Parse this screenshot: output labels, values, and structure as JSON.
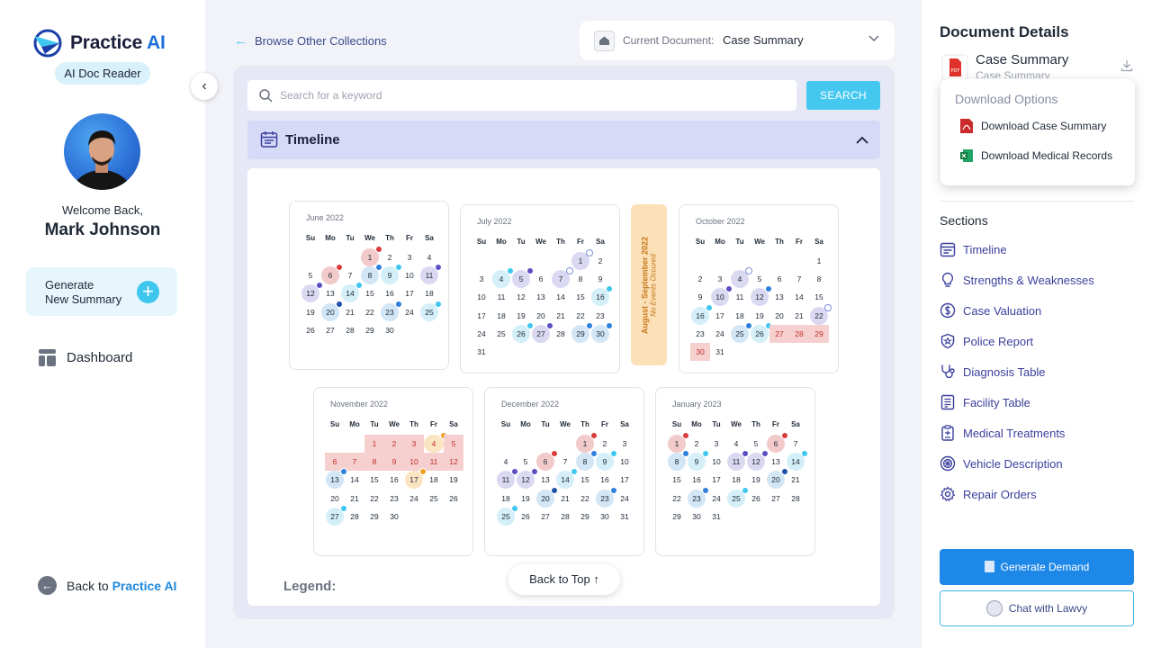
{
  "brand": {
    "name_part1": "Practice",
    "name_part2": "AI",
    "badge": "AI Doc Reader",
    "accent": "#1e6fd9"
  },
  "user": {
    "welcome": "Welcome Back,",
    "name": "Mark Johnson"
  },
  "sidebar": {
    "generate_label_line1": "Generate",
    "generate_label_line2": "New Summary",
    "nav": [
      {
        "label": "Dashboard",
        "icon": "dashboard-icon"
      }
    ],
    "back_prefix": "Back to",
    "back_link": "Practice AI"
  },
  "main": {
    "browse_label": "Browse Other Collections",
    "current_doc_label": "Current Document:",
    "current_doc_value": "Case Summary",
    "search": {
      "placeholder": "Search for a keyword",
      "button": "SEARCH"
    },
    "section_title": "Timeline",
    "gap_title": "August - September 2022",
    "gap_sub": "No Events Occured",
    "legend_label": "Legend:",
    "back_to_top": "Back to Top"
  },
  "weekdays": [
    "Su",
    "Mo",
    "Tu",
    "We",
    "Th",
    "Fr",
    "Sa"
  ],
  "calendars": [
    {
      "name": "June 2022",
      "start": 3,
      "days": 30,
      "marks": {
        "1": [
          "red",
          "r"
        ],
        "6": [
          "red",
          "r"
        ],
        "8": [
          "blue",
          "b"
        ],
        "9": [
          "cyan",
          "c"
        ],
        "11": [
          "purple",
          "p"
        ],
        "12": [
          "purple",
          "p"
        ],
        "14": [
          "cyan",
          "c"
        ],
        "20": [
          "blue",
          "bl"
        ],
        "23": [
          "blue",
          "b"
        ],
        "25": [
          "cyan",
          "c"
        ]
      }
    },
    {
      "name": "July 2022",
      "start": 5,
      "days": 31,
      "marks": {
        "1": [
          "purple",
          "ring"
        ],
        "4": [
          "cyan",
          "c"
        ],
        "5": [
          "purple",
          "p"
        ],
        "7": [
          "purple",
          "ring"
        ],
        "16": [
          "cyan",
          "c"
        ],
        "26": [
          "cyan",
          "c"
        ],
        "27": [
          "purple",
          "p"
        ],
        "29": [
          "blue",
          "b"
        ],
        "30": [
          "blue",
          "b"
        ]
      }
    },
    {
      "name": "October 2022",
      "start": 6,
      "days": 31,
      "marks": {
        "4": [
          "purple",
          "ring"
        ],
        "10": [
          "purple",
          "p"
        ],
        "12": [
          "purple",
          "b"
        ],
        "16": [
          "cyan",
          "c"
        ],
        "22": [
          "purple",
          "ring"
        ],
        "25": [
          "blue",
          "b"
        ],
        "26": [
          "cyan",
          "c"
        ]
      },
      "range": [
        27,
        30
      ]
    },
    {
      "name": "November 2022",
      "start": 2,
      "days": 30,
      "marks": {
        "4": [
          "orange",
          "o"
        ],
        "13": [
          "blue",
          "b"
        ],
        "17": [
          "orange",
          "o"
        ],
        "27": [
          "cyan",
          "c"
        ]
      },
      "range": [
        1,
        12
      ]
    },
    {
      "name": "December 2022",
      "start": 4,
      "days": 31,
      "marks": {
        "1": [
          "red",
          "r"
        ],
        "6": [
          "red",
          "r"
        ],
        "8": [
          "blue",
          "b"
        ],
        "9": [
          "cyan",
          "c"
        ],
        "11": [
          "purple",
          "p"
        ],
        "12": [
          "purple",
          "p"
        ],
        "14": [
          "cyan",
          "c"
        ],
        "20": [
          "blue",
          "bl"
        ],
        "23": [
          "blue",
          "b"
        ],
        "25": [
          "cyan",
          "c"
        ]
      }
    },
    {
      "name": "January 2023",
      "start": 0,
      "days": 31,
      "marks": {
        "1": [
          "red",
          "r"
        ],
        "6": [
          "red",
          "r"
        ],
        "8": [
          "blue",
          "b"
        ],
        "9": [
          "cyan",
          "c"
        ],
        "11": [
          "purple",
          "p"
        ],
        "12": [
          "purple",
          "p"
        ],
        "14": [
          "cyan",
          "c"
        ],
        "20": [
          "blue",
          "bl"
        ],
        "23": [
          "blue",
          "b"
        ],
        "25": [
          "cyan",
          "c"
        ]
      }
    }
  ],
  "details": {
    "title": "Document Details",
    "doc_name": "Case Summary",
    "doc_sub": "Case Summary",
    "download_header": "Download Options",
    "download_items": [
      "Download Case Summary",
      "Download Medical Records"
    ],
    "sections_title": "Sections",
    "sections": [
      {
        "label": "Timeline",
        "icon": "calendar-icon"
      },
      {
        "label": "Strengths & Weaknesses",
        "icon": "lightbulb-icon"
      },
      {
        "label": "Case Valuation",
        "icon": "dollar-icon"
      },
      {
        "label": "Police Report",
        "icon": "badge-icon"
      },
      {
        "label": "Diagnosis Table",
        "icon": "stethoscope-icon"
      },
      {
        "label": "Facility Table",
        "icon": "document-icon"
      },
      {
        "label": "Medical Treatments",
        "icon": "clipboard-icon"
      },
      {
        "label": "Vehicle Description",
        "icon": "wheel-icon"
      },
      {
        "label": "Repair Orders",
        "icon": "gear-icon"
      }
    ],
    "generate_demand": "Generate Demand",
    "chat": "Chat with Lawvy"
  }
}
